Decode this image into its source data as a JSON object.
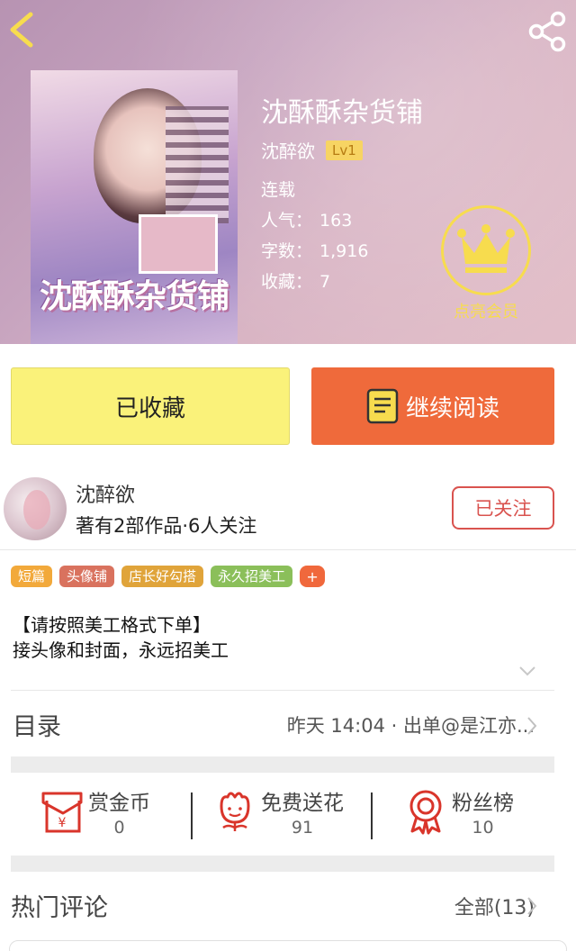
{
  "book": {
    "title": "沈酥酥杂货铺",
    "author": "沈醉欲",
    "level": "Lv1",
    "status": "连载",
    "popularity_label": "人气：",
    "popularity": "163",
    "words_label": "字数：",
    "words": "1,916",
    "favorites_label": "收藏：",
    "favorites": "7",
    "cover_title": "沈酥酥杂货铺"
  },
  "vip": {
    "label": "点亮会员"
  },
  "actions": {
    "collected_label": "已收藏",
    "read_label": "继续阅读"
  },
  "author_block": {
    "name": "沈醉欲",
    "stats": "著有2部作品·6人关注",
    "follow_label": "已关注"
  },
  "tags": [
    {
      "label": "短篇",
      "color": "#f2a93b"
    },
    {
      "label": "头像铺",
      "color": "#d9725e"
    },
    {
      "label": "店长好勾搭",
      "color": "#e0a43a"
    },
    {
      "label": "永久招美工",
      "color": "#8bbf5a"
    }
  ],
  "tag_more": "+",
  "intro": {
    "line1": "【请按照美工格式下单】",
    "line2": "接头像和封面，永远招美工"
  },
  "catalog": {
    "label": "目录",
    "latest": "昨天 14:04 · 出单@是江亦..."
  },
  "rewards": [
    {
      "label": "赏金币",
      "value": "0",
      "icon": "red-envelope-icon"
    },
    {
      "label": "免费送花",
      "value": "91",
      "icon": "flower-icon"
    },
    {
      "label": "粉丝榜",
      "value": "10",
      "icon": "medal-icon"
    }
  ],
  "comments": {
    "label": "热门评论",
    "all_label": "全部(13)"
  },
  "colors": {
    "accent": "#ef6a3b",
    "collected": "#faf27a",
    "follow": "#d9534f",
    "vip": "#f7dc4e",
    "icon_red": "#d9352b"
  }
}
